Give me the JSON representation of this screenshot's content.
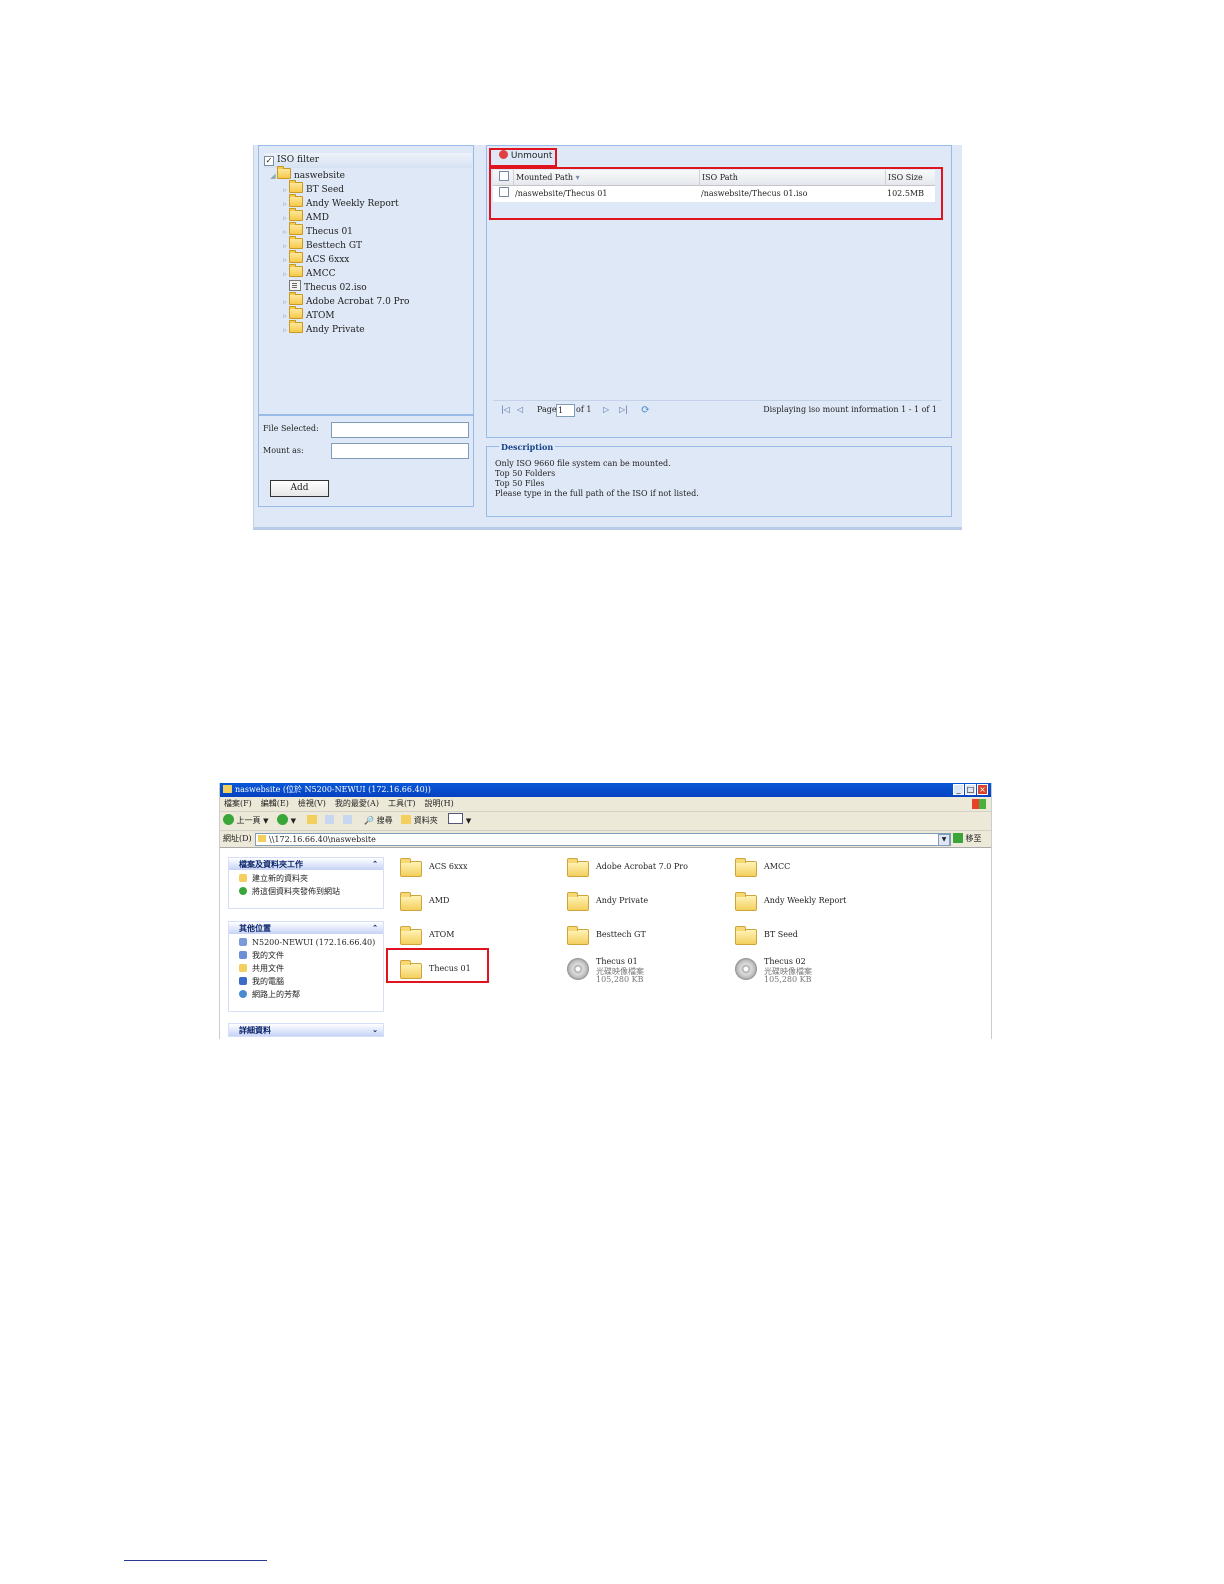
{
  "iso_mount": {
    "tree": {
      "filter_label": "ISO filter",
      "root": "naswebsite",
      "items": [
        {
          "label": "BT Seed",
          "type": "folder"
        },
        {
          "label": "Andy Weekly Report",
          "type": "folder"
        },
        {
          "label": "AMD",
          "type": "folder"
        },
        {
          "label": "Thecus 01",
          "type": "folder"
        },
        {
          "label": "Besttech GT",
          "type": "folder"
        },
        {
          "label": "ACS 6xxx",
          "type": "folder"
        },
        {
          "label": "AMCC",
          "type": "folder"
        },
        {
          "label": "Thecus 02.iso",
          "type": "iso"
        },
        {
          "label": "Adobe Acrobat 7.0 Pro",
          "type": "folder"
        },
        {
          "label": "ATOM",
          "type": "folder"
        },
        {
          "label": "Andy Private",
          "type": "folder"
        }
      ]
    },
    "form": {
      "file_selected_label": "File Selected:",
      "mount_as_label": "Mount as:",
      "add_button": "Add"
    },
    "unmount_button": "Unmount",
    "grid": {
      "columns": [
        "Mounted Path",
        "ISO Path",
        "ISO Size"
      ],
      "rows": [
        {
          "mounted_path": "/naswebsite/Thecus 01",
          "iso_path": "/naswebsite/Thecus 01.iso",
          "iso_size": "102.5MB"
        }
      ]
    },
    "pager": {
      "page_label": "Page",
      "page_value": "1",
      "of_label": "of 1",
      "display_info": "Displaying iso mount information 1 - 1 of 1"
    },
    "description": {
      "title": "Description",
      "lines": [
        "Only ISO 9660 file system can be mounted.",
        "Top 50 Folders",
        "Top 50 Files",
        "Please type in the full path of the ISO if not listed."
      ]
    }
  },
  "explorer": {
    "title": "naswebsite (位於 N5200-NEWUI (172.16.66.40))",
    "menu": [
      "檔案(F)",
      "編輯(E)",
      "檢視(V)",
      "我的最愛(A)",
      "工具(T)",
      "說明(H)"
    ],
    "toolbar": {
      "back": "上一頁",
      "search": "搜尋",
      "folders": "資料夾"
    },
    "address": {
      "label": "網址(D)",
      "value": "\\\\172.16.66.40\\naswebsite",
      "go": "移至"
    },
    "tasks": {
      "header": "檔案及資料夾工作",
      "items": [
        "建立新的資料夾",
        "將這個資料夾發佈到網站"
      ]
    },
    "places": {
      "header": "其他位置",
      "items": [
        "N5200-NEWUI (172.16.66.40)",
        "我的文件",
        "共用文件",
        "我的電腦",
        "網路上的芳鄰"
      ]
    },
    "details": {
      "header": "詳細資料"
    },
    "files": [
      {
        "name": "ACS 6xxx",
        "type": "folder"
      },
      {
        "name": "Adobe Acrobat 7.0 Pro",
        "type": "folder"
      },
      {
        "name": "AMCC",
        "type": "folder"
      },
      {
        "name": "AMD",
        "type": "folder"
      },
      {
        "name": "Andy Private",
        "type": "folder"
      },
      {
        "name": "Andy Weekly Report",
        "type": "folder"
      },
      {
        "name": "ATOM",
        "type": "folder"
      },
      {
        "name": "Besttech GT",
        "type": "folder"
      },
      {
        "name": "BT Seed",
        "type": "folder"
      },
      {
        "name": "Thecus 01",
        "type": "folder"
      },
      {
        "name": "Thecus 01",
        "type": "iso",
        "kind": "光碟映像檔案",
        "size": "105,280 KB"
      },
      {
        "name": "Thecus 02",
        "type": "iso",
        "kind": "光碟映像檔案",
        "size": "105,280 KB"
      }
    ]
  }
}
